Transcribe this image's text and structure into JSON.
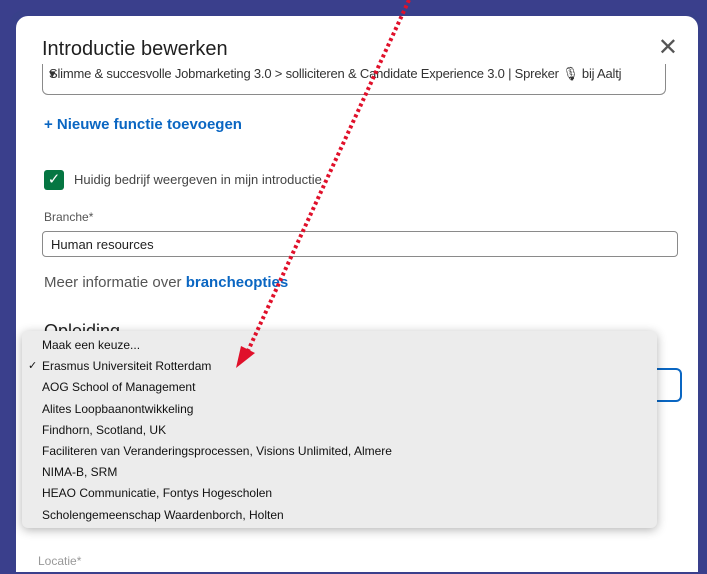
{
  "modal": {
    "title": "Introductie bewerken",
    "close_icon": "✕"
  },
  "position_select": {
    "clipped_value": "Slimme & succesvolle Jobmarketing 3.0 > solliciteren & Candidate Experience 3.0 | Spreker 🎙 bij Aaltj"
  },
  "add_position_link": "+ Nieuwe functie toevoegen",
  "current_company_checkbox": {
    "checked": true,
    "label": "Huidig bedrijf weergeven in mijn introductie"
  },
  "industry": {
    "label": "Branche*",
    "value": "Human resources",
    "info_prefix": "Meer informatie over ",
    "info_link": "brancheopties"
  },
  "education": {
    "heading": "Opleiding",
    "dropdown_options": [
      {
        "label": "Maak een keuze...",
        "selected": false
      },
      {
        "label": "Erasmus Universiteit Rotterdam",
        "selected": true
      },
      {
        "label": "AOG School of Management",
        "selected": false
      },
      {
        "label": "Alites Loopbaanontwikkeling",
        "selected": false
      },
      {
        "label": "Findhorn, Scotland, UK",
        "selected": false
      },
      {
        "label": "Faciliteren van Veranderingsprocessen, Visions Unlimited, Almere",
        "selected": false
      },
      {
        "label": "NIMA-B, SRM",
        "selected": false
      },
      {
        "label": "HEAO Communicatie, Fontys Hogescholen",
        "selected": false
      },
      {
        "label": "Scholengemeenschap Waardenborch, Holten",
        "selected": false
      }
    ]
  },
  "colors": {
    "frame_background": "#3a3f8c",
    "link_blue": "#0a66c2",
    "checkbox_green": "#057642",
    "annotation_arrow": "#e0102a"
  },
  "annotation": {
    "icon": "dotted-red-arrow"
  }
}
